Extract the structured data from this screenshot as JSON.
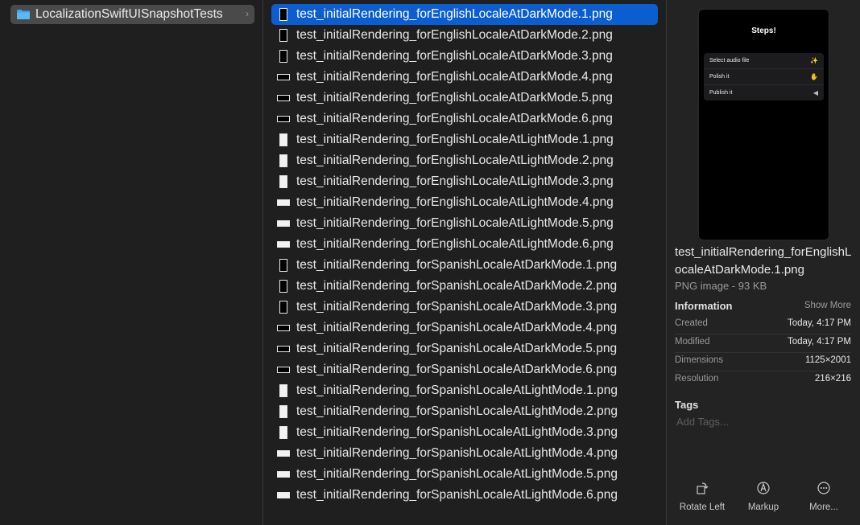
{
  "sidebar": {
    "folder_name": "LocalizationSwiftUISnapshotTests"
  },
  "files": [
    {
      "name": "test_initialRendering_forEnglishLocaleAtDarkMode.1.png",
      "thumb": "dark-p",
      "selected": true
    },
    {
      "name": "test_initialRendering_forEnglishLocaleAtDarkMode.2.png",
      "thumb": "dark-p"
    },
    {
      "name": "test_initialRendering_forEnglishLocaleAtDarkMode.3.png",
      "thumb": "dark-p"
    },
    {
      "name": "test_initialRendering_forEnglishLocaleAtDarkMode.4.png",
      "thumb": "dark-l"
    },
    {
      "name": "test_initialRendering_forEnglishLocaleAtDarkMode.5.png",
      "thumb": "dark-l"
    },
    {
      "name": "test_initialRendering_forEnglishLocaleAtDarkMode.6.png",
      "thumb": "dark-l"
    },
    {
      "name": "test_initialRendering_forEnglishLocaleAtLightMode.1.png",
      "thumb": "light-p"
    },
    {
      "name": "test_initialRendering_forEnglishLocaleAtLightMode.2.png",
      "thumb": "light-p"
    },
    {
      "name": "test_initialRendering_forEnglishLocaleAtLightMode.3.png",
      "thumb": "light-p"
    },
    {
      "name": "test_initialRendering_forEnglishLocaleAtLightMode.4.png",
      "thumb": "light-l"
    },
    {
      "name": "test_initialRendering_forEnglishLocaleAtLightMode.5.png",
      "thumb": "light-l"
    },
    {
      "name": "test_initialRendering_forEnglishLocaleAtLightMode.6.png",
      "thumb": "light-l"
    },
    {
      "name": "test_initialRendering_forSpanishLocaleAtDarkMode.1.png",
      "thumb": "dark-p"
    },
    {
      "name": "test_initialRendering_forSpanishLocaleAtDarkMode.2.png",
      "thumb": "dark-p"
    },
    {
      "name": "test_initialRendering_forSpanishLocaleAtDarkMode.3.png",
      "thumb": "dark-p"
    },
    {
      "name": "test_initialRendering_forSpanishLocaleAtDarkMode.4.png",
      "thumb": "dark-l"
    },
    {
      "name": "test_initialRendering_forSpanishLocaleAtDarkMode.5.png",
      "thumb": "dark-l"
    },
    {
      "name": "test_initialRendering_forSpanishLocaleAtDarkMode.6.png",
      "thumb": "dark-l"
    },
    {
      "name": "test_initialRendering_forSpanishLocaleAtLightMode.1.png",
      "thumb": "light-p"
    },
    {
      "name": "test_initialRendering_forSpanishLocaleAtLightMode.2.png",
      "thumb": "light-p"
    },
    {
      "name": "test_initialRendering_forSpanishLocaleAtLightMode.3.png",
      "thumb": "light-p"
    },
    {
      "name": "test_initialRendering_forSpanishLocaleAtLightMode.4.png",
      "thumb": "light-l"
    },
    {
      "name": "test_initialRendering_forSpanishLocaleAtLightMode.5.png",
      "thumb": "light-l"
    },
    {
      "name": "test_initialRendering_forSpanishLocaleAtLightMode.6.png",
      "thumb": "light-l"
    }
  ],
  "preview": {
    "title": "Steps!",
    "items": [
      {
        "label": "Select audio file",
        "icon": "sparkle-icon"
      },
      {
        "label": "Polish it",
        "icon": "hand-icon"
      },
      {
        "label": "Publish it",
        "icon": "megaphone-icon"
      }
    ]
  },
  "info": {
    "file_name": "test_initialRendering_forEnglishLocaleAtDarkMode.1.png",
    "kind_size": "PNG image - 93 KB",
    "information_heading": "Information",
    "show_more": "Show More",
    "rows": [
      {
        "key": "Created",
        "value": "Today, 4:17 PM"
      },
      {
        "key": "Modified",
        "value": "Today, 4:17 PM"
      },
      {
        "key": "Dimensions",
        "value": "1125×2001"
      },
      {
        "key": "Resolution",
        "value": "216×216"
      }
    ],
    "tags_heading": "Tags",
    "tags_placeholder": "Add Tags..."
  },
  "actions": [
    {
      "label": "Rotate Left",
      "icon": "rotate-left-icon"
    },
    {
      "label": "Markup",
      "icon": "markup-icon"
    },
    {
      "label": "More...",
      "icon": "more-icon"
    }
  ],
  "colors": {
    "selection": "#0b5ecf",
    "folder": "#3fa5f0"
  }
}
